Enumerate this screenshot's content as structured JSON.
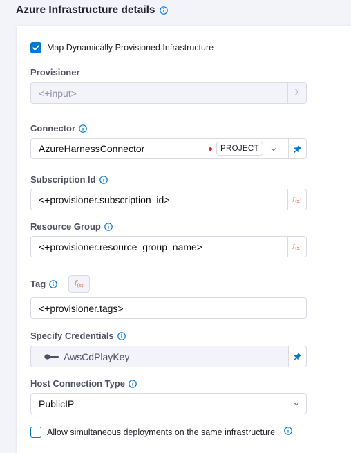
{
  "heading": "Azure Infrastructure details",
  "map_dynamic": {
    "label": "Map Dynamically Provisioned Infrastructure",
    "checked": true
  },
  "provisioner": {
    "label": "Provisioner",
    "placeholder": "<+input>"
  },
  "connector": {
    "label": "Connector",
    "value": "AzureHarnessConnector",
    "scope_badge": "PROJECT"
  },
  "subscription": {
    "label": "Subscription Id",
    "value": "<+provisioner.subscription_id>"
  },
  "resource_group": {
    "label": "Resource Group",
    "value": "<+provisioner.resource_group_name>"
  },
  "tag": {
    "label": "Tag",
    "value": "<+provisioner.tags>"
  },
  "credentials": {
    "label": "Specify Credentials",
    "value": "AwsCdPlayKey"
  },
  "host_connection": {
    "label": "Host Connection Type",
    "value": "PublicIP"
  },
  "allow_simultaneous": {
    "label": "Allow simultaneous deployments on the same infrastructure",
    "checked": false
  },
  "colors": {
    "accent": "#0278d5",
    "expression": "#e9734b",
    "status_dot": "#da291d"
  }
}
